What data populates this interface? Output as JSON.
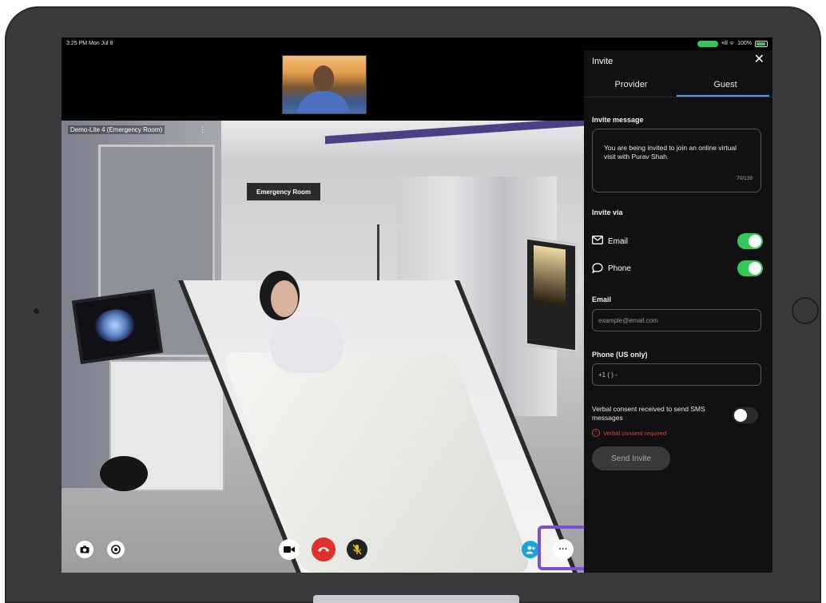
{
  "status_bar": {
    "time": "3:25 PM  Mon Jul 8",
    "battery": "100%"
  },
  "video": {
    "room_label": "Demo-Lite 4 (Emergency Room)",
    "room_menu": "⋮",
    "sign_text": "Emergency Room"
  },
  "invite_panel": {
    "title": "Invite",
    "close": "✕",
    "tabs": [
      "Provider",
      "Guest"
    ],
    "active_tab": "Guest",
    "message_label": "Invite message",
    "message_text": "You are being invited to join an online virtual visit with Purav Shah.",
    "message_count": "70/139",
    "invite_via_label": "Invite via",
    "channels": [
      {
        "label": "Email",
        "enabled": true
      },
      {
        "label": "Phone",
        "enabled": true
      }
    ],
    "email_label": "Email",
    "email_placeholder": "example@email.com",
    "phone_label": "Phone (US only)",
    "phone_value": "+1 (  ) -",
    "consent_text": "Verbal consent received to send SMS messages",
    "consent_enabled": false,
    "consent_error": "Verbal consent required",
    "send_button": "Send Invite"
  },
  "controls": {
    "more_label": "···"
  },
  "colors": {
    "toggle_on": "#34c759",
    "accent_tab": "#3aa6ff",
    "end_call": "#e0302b",
    "mute": "#f2c200",
    "participants": "#1aa3d9",
    "highlight_ring": "#7a4fd6",
    "error": "#e23b3b"
  }
}
